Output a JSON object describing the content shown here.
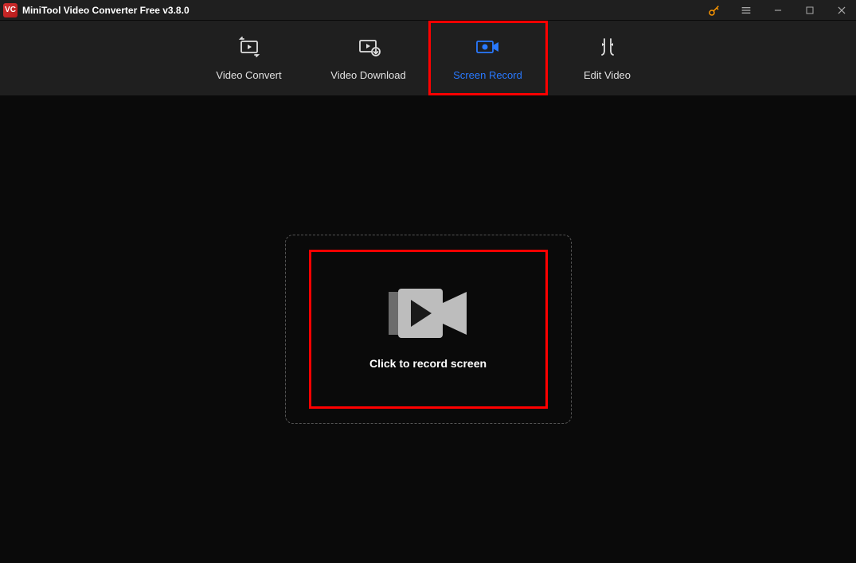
{
  "titlebar": {
    "app_title": "MiniTool Video Converter Free v3.8.0",
    "logo_text": "VC"
  },
  "nav": {
    "items": [
      {
        "label": "Video Convert"
      },
      {
        "label": "Video Download"
      },
      {
        "label": "Screen Record"
      },
      {
        "label": "Edit Video"
      }
    ]
  },
  "main": {
    "record_label": "Click to record screen"
  },
  "colors": {
    "accent": "#2979ff",
    "highlight": "#ff0000",
    "key_icon": "#ff9800"
  }
}
